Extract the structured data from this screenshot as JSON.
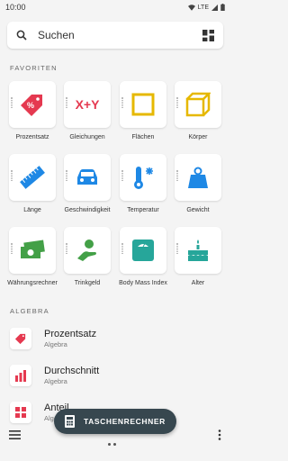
{
  "status": {
    "time": "10:00",
    "network": "LTE"
  },
  "search": {
    "label": "Suchen"
  },
  "sections": {
    "favorites": "FAVORITEN",
    "algebra": "ALGEBRA"
  },
  "favorites": [
    {
      "label": "Prozentsatz",
      "icon": "percent-tag-icon",
      "color": "#e53950"
    },
    {
      "label": "Gleichungen",
      "icon": "x-plus-y-icon",
      "color": "#e53950"
    },
    {
      "label": "Flächen",
      "icon": "square-icon",
      "color": "#e6b800"
    },
    {
      "label": "Körper",
      "icon": "cube-icon",
      "color": "#e6b800"
    },
    {
      "label": "Länge",
      "icon": "ruler-icon",
      "color": "#1e88e5"
    },
    {
      "label": "Geschwindigkeit",
      "icon": "car-icon",
      "color": "#1e88e5"
    },
    {
      "label": "Temperatur",
      "icon": "thermometer-icon",
      "color": "#1e88e5"
    },
    {
      "label": "Gewicht",
      "icon": "weight-icon",
      "color": "#1e88e5"
    },
    {
      "label": "Währungsrechner",
      "icon": "money-icon",
      "color": "#43a047"
    },
    {
      "label": "Trinkgeld",
      "icon": "tip-hand-icon",
      "color": "#43a047"
    },
    {
      "label": "Body Mass Index",
      "icon": "scale-icon",
      "color": "#26a69a"
    },
    {
      "label": "Alter",
      "icon": "cake-icon",
      "color": "#26a69a"
    }
  ],
  "algebra": [
    {
      "title": "Prozentsatz",
      "subtitle": "Algebra",
      "icon": "percent-tag-icon"
    },
    {
      "title": "Durchschnitt",
      "subtitle": "Algebra",
      "icon": "bar-chart-icon"
    },
    {
      "title": "Anteil",
      "subtitle": "Algebra",
      "icon": "grid-icon"
    }
  ],
  "fab": {
    "label": "TASCHENRECHNER"
  }
}
